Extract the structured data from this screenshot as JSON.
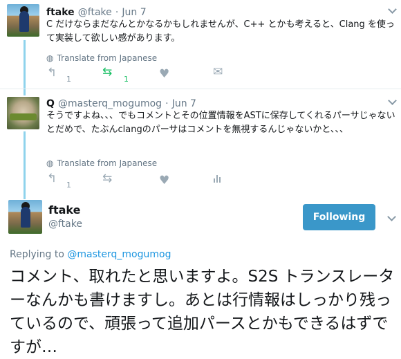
{
  "tweet1": {
    "name": "ftake",
    "handle": "@ftake",
    "dot": "·",
    "date": "Jun 7",
    "text": "C だけならまだなんとかなるかもしれませんが、C++ とかも考えると、Clang を使って実装して欲しい感があります。",
    "translate": "Translate from Japanese",
    "reply_count": "1",
    "retweet_count": "1"
  },
  "tweet2": {
    "name": "Q",
    "handle": "@masterq_mogumog",
    "dot": "·",
    "date": "Jun 7",
    "text": "そうですよね、、、でもコメントとその位置情報をASTに保存してくれるパーサじゃないとだめで、たぶんclangのパーサはコメントを無視するんじゃないかと、、、",
    "translate": "Translate from Japanese",
    "reply_count": "1"
  },
  "main": {
    "name": "ftake",
    "handle": "@ftake",
    "follow_label": "Following",
    "replying_prefix": "Replying to",
    "replying_to": "@masterq_mogumog",
    "text": "コメント、取れたと思いますよ。S2S トランスレーターなんかも書けますし。あとは行情報はしっかり残っているので、頑張って追加パースとかもできるはずですが…"
  },
  "colors": {
    "accent": "#3a97c9",
    "retweet": "#17bf63",
    "thread": "#8fd3ec"
  },
  "icons": [
    "reply-icon",
    "retweet-icon",
    "like-icon",
    "message-icon",
    "analytics-icon",
    "globe-icon",
    "chevron-down-icon"
  ]
}
